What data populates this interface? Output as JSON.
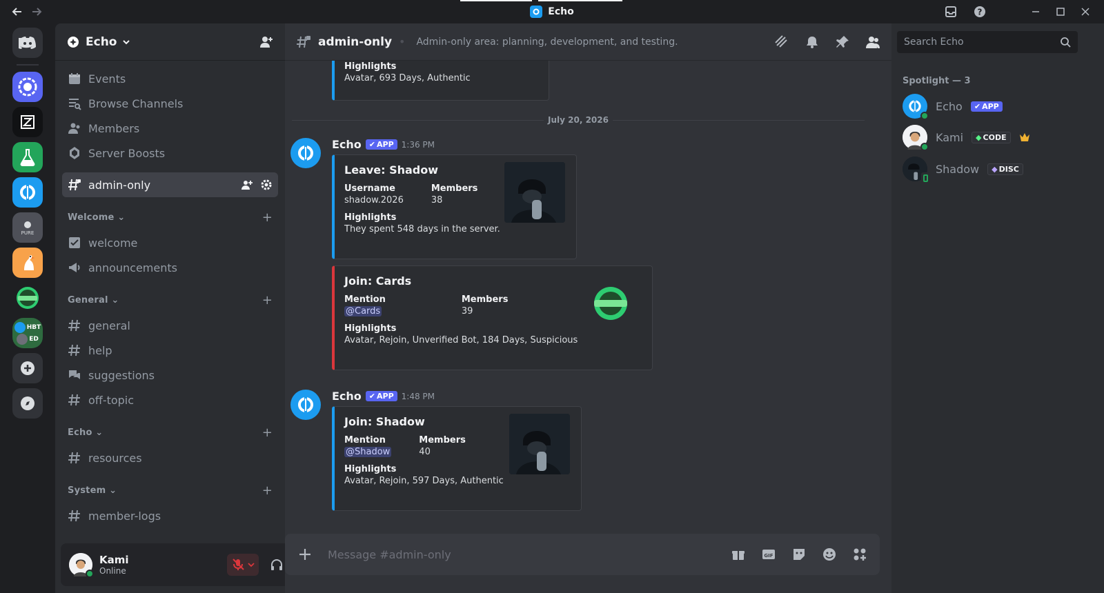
{
  "window": {
    "title": "Echo"
  },
  "server": {
    "name": "Echo"
  },
  "sidebar": {
    "nav": [
      {
        "label": "Events"
      },
      {
        "label": "Browse Channels"
      },
      {
        "label": "Members"
      },
      {
        "label": "Server Boosts"
      }
    ],
    "active_channel": "admin-only",
    "categories": [
      {
        "name": "Welcome",
        "channels": [
          "welcome",
          "announcements"
        ]
      },
      {
        "name": "General",
        "channels": [
          "general",
          "help",
          "suggestions",
          "off-topic"
        ]
      },
      {
        "name": "Echo",
        "channels": [
          "resources"
        ]
      },
      {
        "name": "System",
        "channels": [
          "member-logs"
        ]
      }
    ]
  },
  "rail": {
    "folder_labels": [
      "HBT",
      "ED"
    ]
  },
  "user": {
    "name": "Kami",
    "status": "Online"
  },
  "channel": {
    "name": "admin-only",
    "topic": "Admin-only area: planning, development, and testing."
  },
  "messages": {
    "top_embed": {
      "highlights_label": "Highlights",
      "highlights": "Avatar, 693 Days, Authentic"
    },
    "date_divider": "July 20, 2026",
    "group1": {
      "author": "Echo",
      "tag": "APP",
      "time": "1:36 PM",
      "embed1": {
        "title": "Leave: Shadow",
        "f1_name": "Username",
        "f1_value": "shadow.2026",
        "f2_name": "Members",
        "f2_value": "38",
        "highlights_label": "Highlights",
        "highlights": "They spent 548 days in the server."
      },
      "embed2": {
        "title": "Join: Cards",
        "f1_name": "Mention",
        "f1_value": "@Cards",
        "f2_name": "Members",
        "f2_value": "39",
        "highlights_label": "Highlights",
        "highlights": "Avatar, Rejoin, Unverified Bot, 184 Days, Suspicious"
      }
    },
    "group2": {
      "author": "Echo",
      "tag": "APP",
      "time": "1:48 PM",
      "embed1": {
        "title": "Join: Shadow",
        "f1_name": "Mention",
        "f1_value": "@Shadow",
        "f2_name": "Members",
        "f2_value": "40",
        "highlights_label": "Highlights",
        "highlights": "Avatar, Rejoin, 597 Days, Authentic"
      }
    }
  },
  "composer": {
    "placeholder": "Message #admin-only"
  },
  "members_panel": {
    "search_placeholder": "Search Echo",
    "section": "Spotlight — 3",
    "members": [
      {
        "name": "Echo",
        "tag": "APP"
      },
      {
        "name": "Kami",
        "tag": "CODE"
      },
      {
        "name": "Shadow",
        "tag": "DISC"
      }
    ]
  },
  "colors": {
    "accent": "#5865f2",
    "echo_blue": "#1c9cf0",
    "online": "#23a55a",
    "leave_red": "#da373c"
  }
}
